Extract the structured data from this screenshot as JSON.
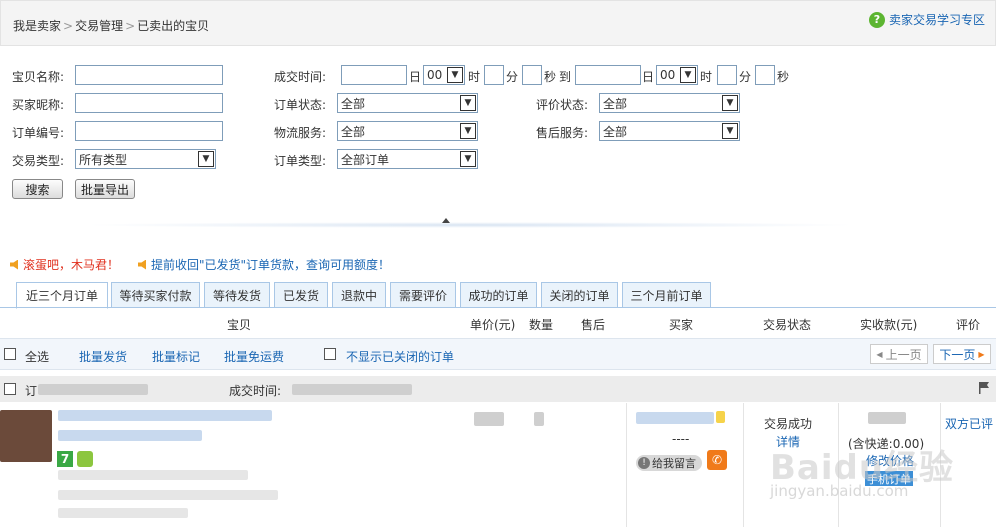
{
  "breadcrumb": [
    "我是卖家",
    "交易管理",
    "已卖出的宝贝"
  ],
  "breadcrumb_sep": ">",
  "help_link": "卖家交易学习专区",
  "help_icon": "question-icon",
  "filters": {
    "item_name_label": "宝贝名称:",
    "buyer_nick_label": "买家昵称:",
    "order_no_label": "订单编号:",
    "trade_type_label": "交易类型:",
    "trade_type_value": "所有类型",
    "deal_time_label": "成交时间:",
    "day_label": "日",
    "hour_value": "00",
    "hour_label": "时",
    "minute_label": "分",
    "second_label": "秒",
    "to_label": "到",
    "order_status_label": "订单状态:",
    "order_status_value": "全部",
    "logistics_label": "物流服务:",
    "logistics_value": "全部",
    "order_type_label": "订单类型:",
    "order_type_value": "全部订单",
    "review_status_label": "评价状态:",
    "review_status_value": "全部",
    "after_sale_label": "售后服务:",
    "after_sale_value": "全部",
    "search_button": "搜索",
    "export_button": "批量导出"
  },
  "notices": [
    "滚蛋吧，木马君！",
    "提前收回\"已发货\"订单货款，查询可用额度！"
  ],
  "notice_colors": {
    "first": "#e0301e",
    "second": "#1a66b3"
  },
  "tabs": [
    "近三个月订单",
    "等待买家付款",
    "等待发货",
    "已发货",
    "退款中",
    "需要评价",
    "成功的订单",
    "关闭的订单",
    "三个月前订单"
  ],
  "active_tab": 0,
  "columns": [
    "宝贝",
    "单价(元)",
    "数量",
    "售后",
    "买家",
    "交易状态",
    "实收款(元)",
    "评价"
  ],
  "actions": {
    "select_all": "全选",
    "batch_ship": "批量发货",
    "batch_mark": "批量标记",
    "batch_free_shipping": "批量免运费",
    "hide_closed": "不显示已关闭的订单",
    "prev_page": "上一页",
    "next_page": "下一页"
  },
  "order": {
    "prefix": "订",
    "deal_time_label": "成交时间:",
    "status": "交易成功",
    "status_color": "#3a8e2a",
    "details": "详情",
    "dash": "----",
    "message_button": "给我留言",
    "fee_partial": "(含快递:0.00)",
    "change_price": "修改价格",
    "mobile_order": "手机订单",
    "review": "双方已评",
    "badge_seven": "7"
  },
  "watermark": {
    "main": "Baidu经验",
    "sub": "jingyan.baidu.com"
  },
  "colors": {
    "link": "#1a66b3",
    "tab_border": "#a9c7e6",
    "accent_orange": "#f07a1a"
  }
}
